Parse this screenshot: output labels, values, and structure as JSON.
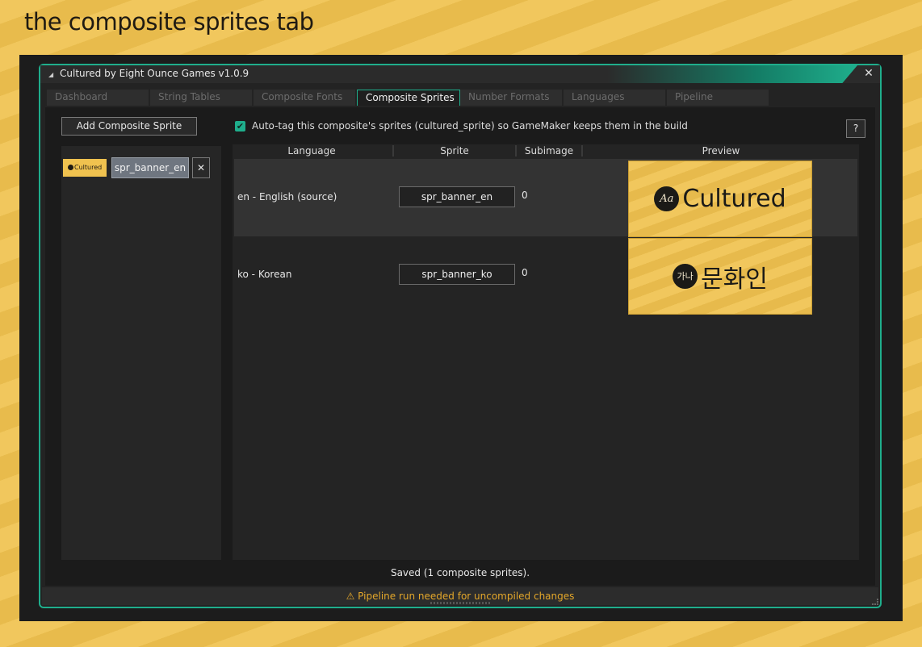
{
  "page_title": "the composite sprites tab",
  "window": {
    "title": "Cultured by Eight Ounce Games  v1.0.9",
    "close_glyph": "✕"
  },
  "tabs": [
    {
      "label": "Dashboard"
    },
    {
      "label": "String Tables"
    },
    {
      "label": "Composite Fonts"
    },
    {
      "label": "Composite Sprites"
    },
    {
      "label": "Number Formats"
    },
    {
      "label": "Languages"
    },
    {
      "label": "Pipeline"
    }
  ],
  "active_tab": "Composite Sprites",
  "toolbar": {
    "add_label": "Add Composite Sprite",
    "autotag_checked": true,
    "autotag_label": "Auto-tag this composite's sprites (cultured_sprite) so GameMaker keeps them in the build",
    "help_label": "?"
  },
  "sprite_list": {
    "items": [
      {
        "thumb_text": "Cultured",
        "name": "spr_banner_en",
        "remove_glyph": "✕"
      }
    ]
  },
  "table": {
    "headers": {
      "language": "Language",
      "sprite": "Sprite",
      "subimage": "Subimage",
      "preview": "Preview"
    },
    "rows": [
      {
        "language": "en - English  (source)",
        "sprite": "spr_banner_en",
        "subimage": "0",
        "preview_badge": "Aa",
        "preview_text": "Cultured"
      },
      {
        "language": "ko - Korean",
        "sprite": "spr_banner_ko",
        "subimage": "0",
        "preview_badge": "가나",
        "preview_text": "문화인"
      }
    ]
  },
  "status": "Saved (1 composite sprites).",
  "footer": {
    "warning": "⚠  Pipeline run needed for uncompiled changes"
  },
  "colors": {
    "accent": "#1fae8c",
    "background": "#f0c24f",
    "warning": "#e4a72a"
  }
}
